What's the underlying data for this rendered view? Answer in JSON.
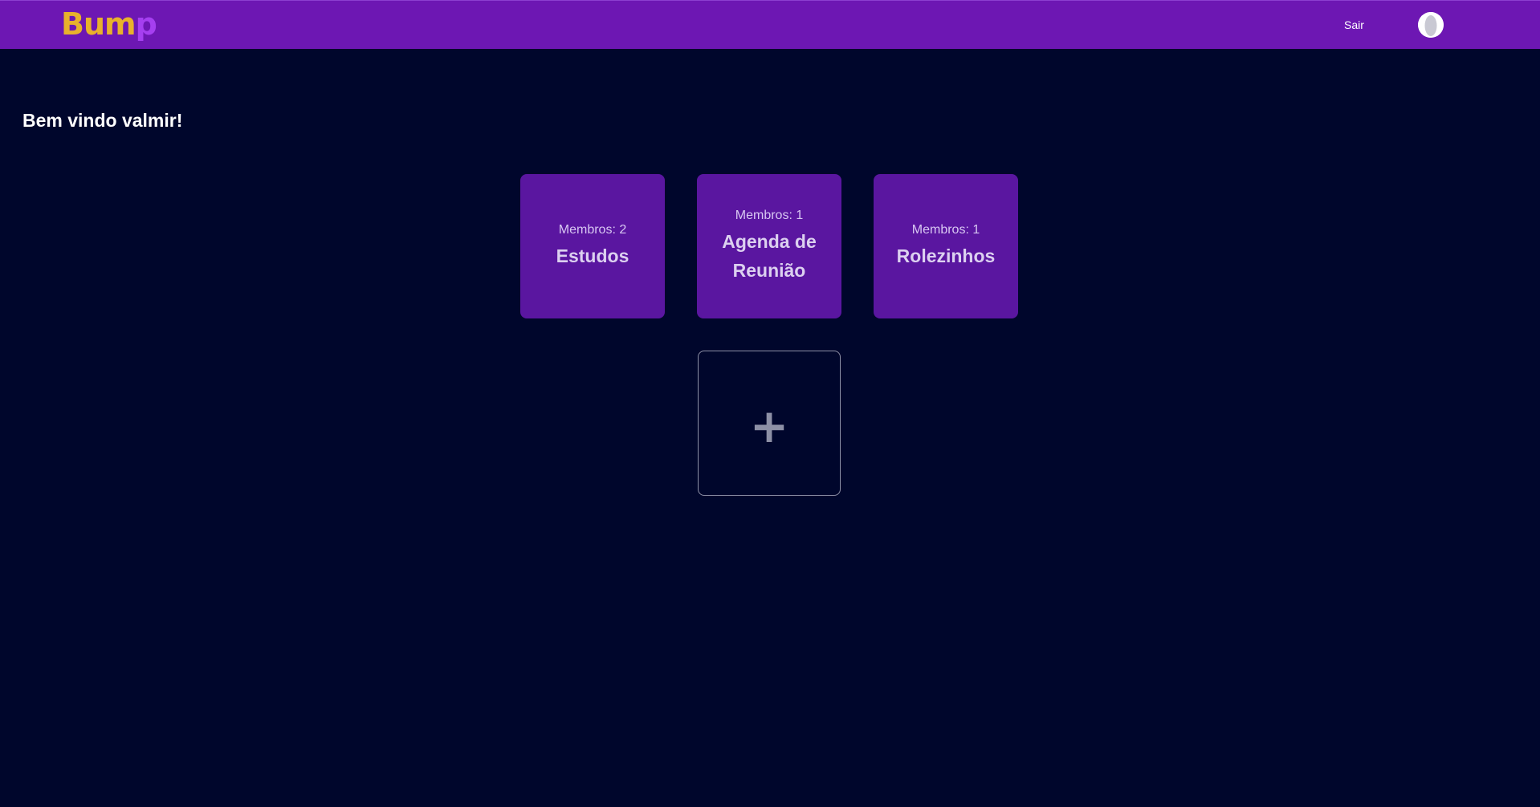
{
  "header": {
    "logo_part1": "Bum",
    "logo_part2": "p",
    "logout_label": "Sair",
    "avatar_icon": "user-avatar-icon"
  },
  "main": {
    "welcome": "Bem vindo valmir!",
    "groups": [
      {
        "members": "Membros: 2",
        "name": "Estudos"
      },
      {
        "members": "Membros: 1",
        "name": "Agenda de Reunião"
      },
      {
        "members": "Membros: 1",
        "name": "Rolezinhos"
      }
    ],
    "add_group_icon": "plus-icon",
    "add_group_symbol": "+"
  },
  "colors": {
    "background": "#00062c",
    "header": "#6d17b3",
    "card": "#5a16a0",
    "logo_yellow": "#e8b12c",
    "logo_purple": "#a53ff0"
  }
}
